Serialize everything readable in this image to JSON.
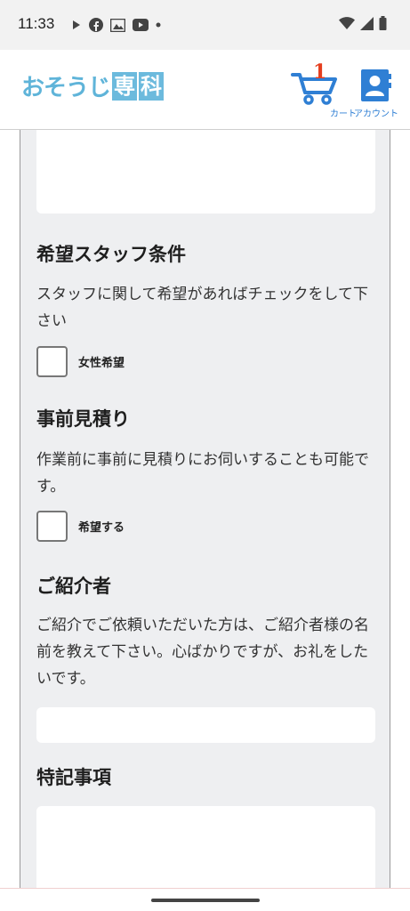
{
  "status_bar": {
    "time": "11:33",
    "left_icons": [
      "play-store-icon",
      "facebook-icon",
      "gallery-icon",
      "youtube-icon",
      "dot-icon"
    ],
    "right_icons": [
      "wifi-icon",
      "signal-icon",
      "battery-icon"
    ]
  },
  "header": {
    "logo_kana": "おそうじ",
    "logo_kanji_1": "専",
    "logo_kanji_2": "科",
    "cart_count": "1",
    "cart_label": "カート",
    "account_label": "アカウント",
    "accent_color": "#2f7fd4",
    "logo_color": "#5fb4d9",
    "badge_color": "#e53e1e"
  },
  "form": {
    "staff": {
      "title": "希望スタッフ条件",
      "description": "スタッフに関して希望があればチェックをして下さい",
      "checkbox_label": "女性希望",
      "checked": false
    },
    "estimate": {
      "title": "事前見積り",
      "description": "作業前に事前に見積りにお伺いすることも可能です。",
      "checkbox_label": "希望する",
      "checked": false
    },
    "referrer": {
      "title": "ご紹介者",
      "description": "ご紹介でご依頼いただいた方は、ご紹介者様の名前を教えて下さい。心ばかりですが、お礼をしたいです。",
      "value": ""
    },
    "notes": {
      "title": "特記事項",
      "value": ""
    }
  }
}
